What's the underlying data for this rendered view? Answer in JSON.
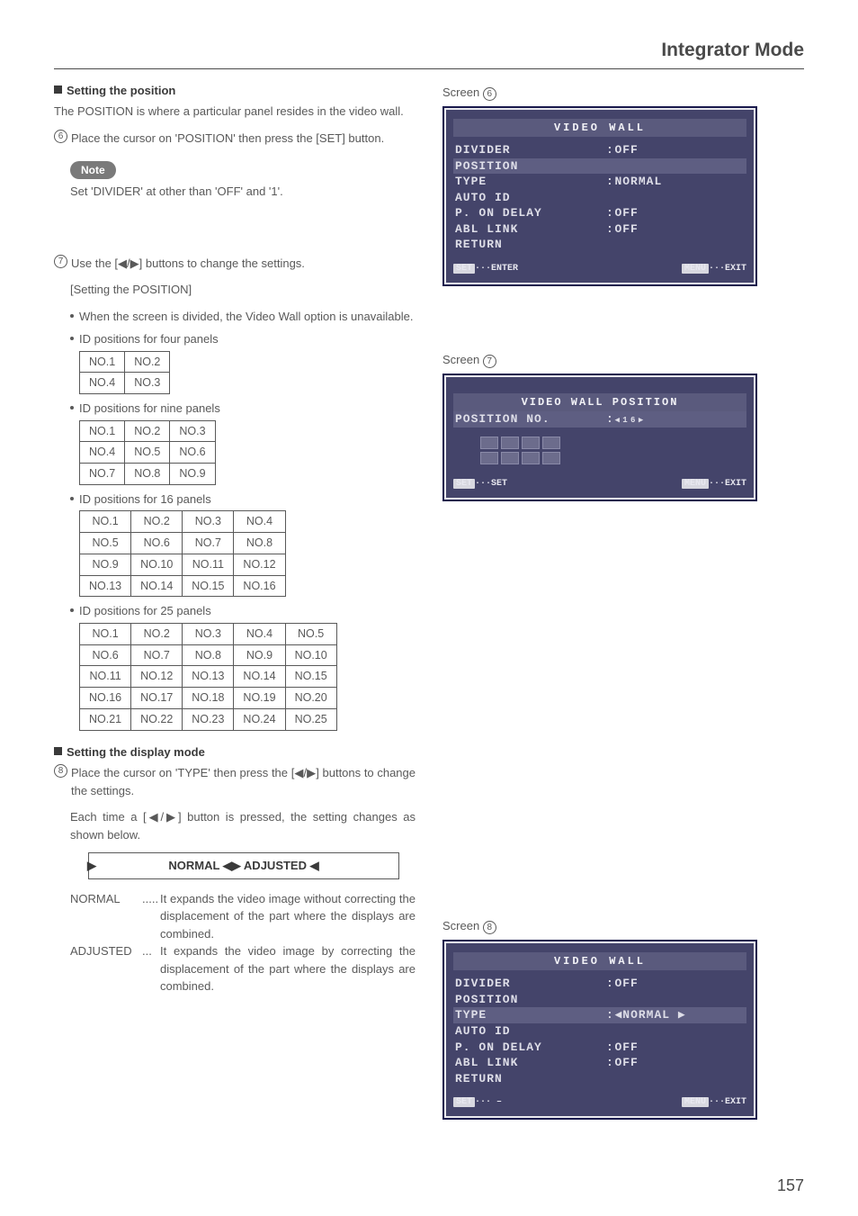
{
  "header": {
    "title": "Integrator Mode"
  },
  "left": {
    "sec1": {
      "heading": "Setting the position",
      "intro": "The POSITION is where a particular panel resides in the video wall.",
      "step6_num": "6",
      "step6": "Place the cursor on 'POSITION' then press the [SET] button.",
      "note_label": "Note",
      "note_text": "Set 'DIVIDER' at other than 'OFF' and '1'."
    },
    "sec2": {
      "step7_num": "7",
      "step7": "Use the  [◀/▶] buttons to change the settings.",
      "sub1": "[Setting the POSITION]",
      "b1": "When the screen is divided, the Video Wall option is unavailable.",
      "b2": "ID positions for four panels",
      "t4": [
        [
          "NO.1",
          "NO.2"
        ],
        [
          "NO.4",
          "NO.3"
        ]
      ],
      "b3": "ID positions for nine panels",
      "t9": [
        [
          "NO.1",
          "NO.2",
          "NO.3"
        ],
        [
          "NO.4",
          "NO.5",
          "NO.6"
        ],
        [
          "NO.7",
          "NO.8",
          "NO.9"
        ]
      ],
      "b4": "ID positions for 16 panels",
      "t16": [
        [
          "NO.1",
          "NO.2",
          "NO.3",
          "NO.4"
        ],
        [
          "NO.5",
          "NO.6",
          "NO.7",
          "NO.8"
        ],
        [
          "NO.9",
          "NO.10",
          "NO.11",
          "NO.12"
        ],
        [
          "NO.13",
          "NO.14",
          "NO.15",
          "NO.16"
        ]
      ],
      "b5": "ID positions for 25 panels",
      "t25": [
        [
          "NO.1",
          "NO.2",
          "NO.3",
          "NO.4",
          "NO.5"
        ],
        [
          "NO.6",
          "NO.7",
          "NO.8",
          "NO.9",
          "NO.10"
        ],
        [
          "NO.11",
          "NO.12",
          "NO.13",
          "NO.14",
          "NO.15"
        ],
        [
          "NO.16",
          "NO.17",
          "NO.18",
          "NO.19",
          "NO.20"
        ],
        [
          "NO.21",
          "NO.22",
          "NO.23",
          "NO.24",
          "NO.25"
        ]
      ]
    },
    "sec3": {
      "heading": "Setting the display mode",
      "step8_num": "8",
      "step8a": "Place the cursor on 'TYPE' then press the [◀/▶] buttons to change the settings.",
      "step8b": "Each time a [◀/▶] button is pressed, the setting changes as shown below.",
      "cycle": "NORMAL ◀▶ ADJUSTED ◀",
      "cycle_left": "▶",
      "normal_label": "NORMAL",
      "normal_dots": ".....",
      "normal_desc": "It expands the video image without correcting the displacement of the part where the displays are combined.",
      "adjusted_label": "ADJUSTED",
      "adjusted_dots": "...",
      "adjusted_desc": "It expands the video image by correcting the displacement of the part where the displays are combined."
    }
  },
  "right": {
    "screen6": {
      "label": "Screen",
      "num": "6",
      "title": "VIDEO WALL",
      "rows": [
        {
          "lbl": "DIVIDER",
          "val": "OFF",
          "hl": false,
          "colon": ":"
        },
        {
          "lbl": "POSITION",
          "val": "",
          "hl": true,
          "colon": ""
        },
        {
          "lbl": "TYPE",
          "val": "NORMAL",
          "hl": false,
          "colon": ":"
        },
        {
          "lbl": "AUTO ID",
          "val": "",
          "hl": false,
          "colon": ""
        },
        {
          "lbl": "P. ON DELAY",
          "val": "OFF",
          "hl": false,
          "colon": ":"
        },
        {
          "lbl": "ABL LINK",
          "val": "OFF",
          "hl": false,
          "colon": ":"
        },
        {
          "lbl": " RETURN",
          "val": "",
          "hl": false,
          "colon": ""
        }
      ],
      "foot_left_btn": "SET",
      "foot_left": "···ENTER",
      "foot_right_btn": "MENU",
      "foot_right": "···EXIT"
    },
    "screen7": {
      "label": "Screen",
      "num": "7",
      "title": "VIDEO WALL POSITION",
      "row_lbl": "POSITION NO.",
      "row_val": "◀ 1 6 ▶",
      "foot_left_btn": "SET",
      "foot_left": "···SET",
      "foot_right_btn": "MENU",
      "foot_right": "···EXIT"
    },
    "screen8": {
      "label": "Screen",
      "num": "8",
      "title": "VIDEO WALL",
      "rows": [
        {
          "lbl": "DIVIDER",
          "val": "OFF",
          "hl": false,
          "colon": ":"
        },
        {
          "lbl": "POSITION",
          "val": "",
          "hl": false,
          "colon": ""
        },
        {
          "lbl": "TYPE",
          "val": "◀NORMAL   ▶",
          "hl": true,
          "colon": ":"
        },
        {
          "lbl": "AUTO ID",
          "val": "",
          "hl": false,
          "colon": ""
        },
        {
          "lbl": "P. ON DELAY",
          "val": "OFF",
          "hl": false,
          "colon": ":"
        },
        {
          "lbl": "ABL LINK",
          "val": "OFF",
          "hl": false,
          "colon": ":"
        },
        {
          "lbl": " RETURN",
          "val": "",
          "hl": false,
          "colon": ""
        }
      ],
      "foot_left_btn": "SET",
      "foot_left": "··· –",
      "foot_right_btn": "MENU",
      "foot_right": "···EXIT"
    }
  },
  "page_number": "157"
}
